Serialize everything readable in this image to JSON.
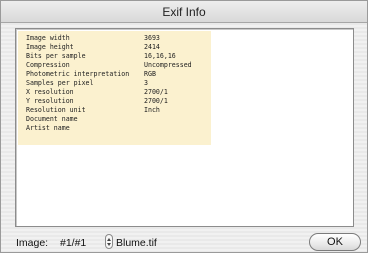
{
  "window": {
    "title": "Exif Info"
  },
  "exif_rows": [
    {
      "key": "Image width",
      "value": "3693"
    },
    {
      "key": "Image height",
      "value": "2414"
    },
    {
      "key": "Bits per sample",
      "value": "16,16,16"
    },
    {
      "key": "Compression",
      "value": "Uncompressed"
    },
    {
      "key": "Photometric interpretation",
      "value": "RGB"
    },
    {
      "key": "Samples per pixel",
      "value": "3"
    },
    {
      "key": "X resolution",
      "value": "2700/1"
    },
    {
      "key": "Y resolution",
      "value": "2700/1"
    },
    {
      "key": "Resolution unit",
      "value": "Inch"
    },
    {
      "key": "Document name",
      "value": ""
    },
    {
      "key": "Artist name",
      "value": ""
    }
  ],
  "footer": {
    "image_label": "Image:",
    "image_index": "#1/#1",
    "file_name": "Blume.tif",
    "ok_label": "OK"
  },
  "colors": {
    "exif_background": "#fbf1cf",
    "window_stripe": "#e9e9e9"
  },
  "icons": [
    "stepper-up-icon",
    "stepper-down-icon"
  ]
}
